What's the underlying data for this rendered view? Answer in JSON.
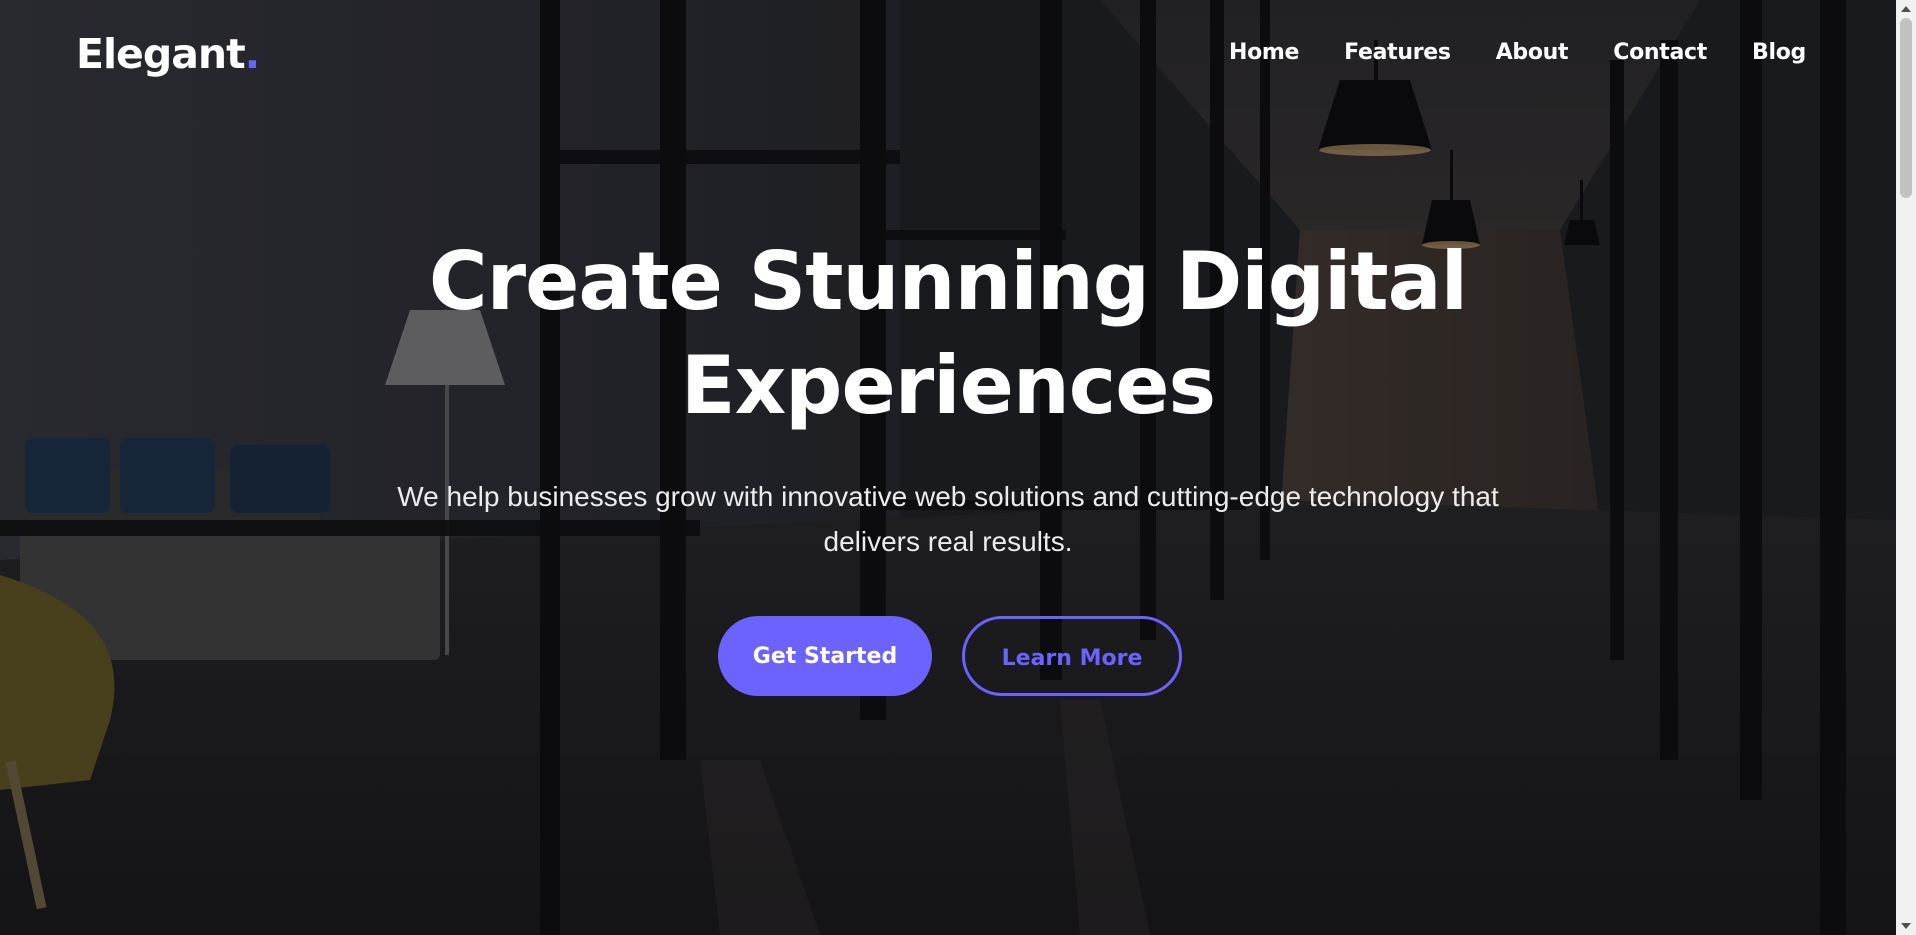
{
  "brand": {
    "name": "Elegant",
    "dot": ".",
    "accent_color": "#6c63ff"
  },
  "nav": {
    "links": [
      {
        "label": "Home"
      },
      {
        "label": "Features"
      },
      {
        "label": "About"
      },
      {
        "label": "Contact"
      },
      {
        "label": "Blog"
      }
    ]
  },
  "hero": {
    "title_line1": "Create Stunning Digital",
    "title_line2": "Experiences",
    "subtitle_line1": "We help businesses grow with innovative web solutions and cutting-edge technology that",
    "subtitle_line2": "delivers real results.",
    "primary_cta": "Get Started",
    "secondary_cta": "Learn More",
    "background_image": "dark-office-corridor-photo"
  }
}
